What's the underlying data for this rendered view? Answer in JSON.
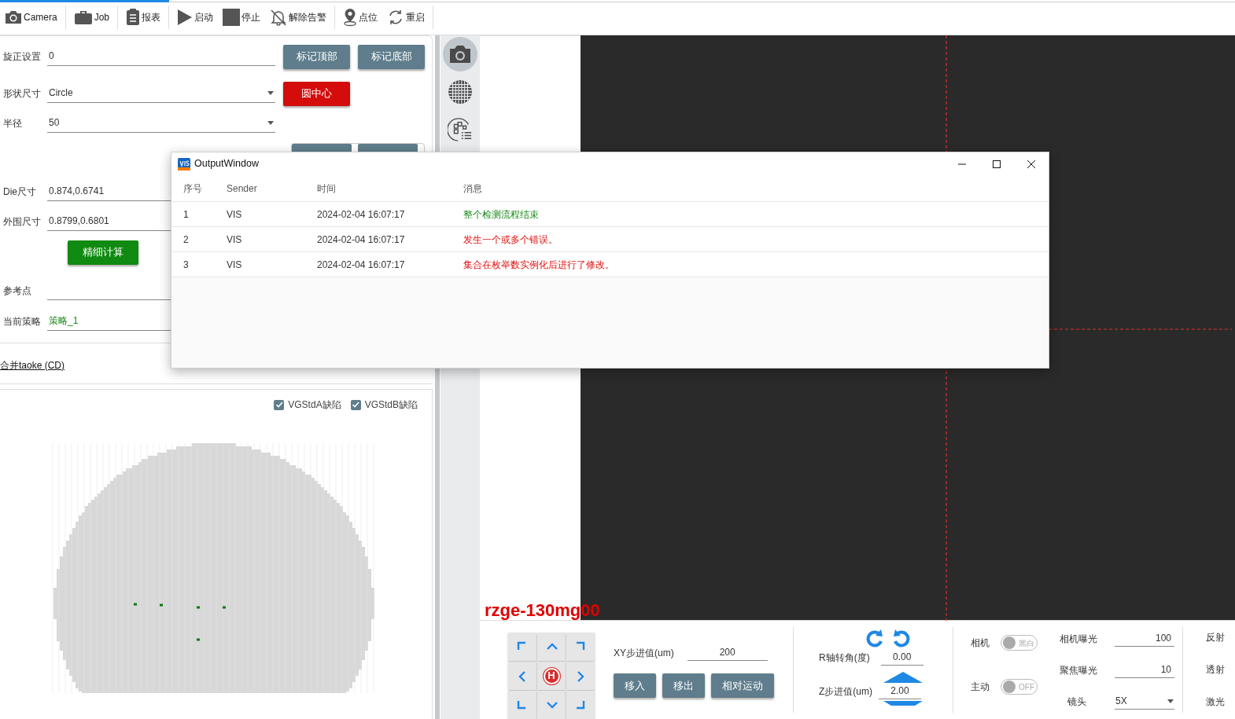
{
  "toolbar": {
    "items": [
      {
        "label": "Camera",
        "group_end": true
      },
      {
        "label": "Job",
        "group_end": true
      },
      {
        "label": "报表",
        "group_end": true
      },
      {
        "label": "启动",
        "group_end": false
      },
      {
        "label": "停止",
        "group_end": false
      },
      {
        "label": "解除告警",
        "group_end": true
      },
      {
        "label": "点位",
        "group_end": false
      },
      {
        "label": "重启",
        "group_end": true
      }
    ]
  },
  "settings": {
    "rows": [
      {
        "kind": "field",
        "label": "旋正设置",
        "value": "0",
        "buttons": [
          {
            "label": "标记顶部",
            "kind": "slate"
          },
          {
            "label": "标记底部",
            "kind": "slate"
          }
        ]
      },
      {
        "kind": "dropdown",
        "label": "形状尺寸",
        "value": "Circle",
        "buttons": [
          {
            "label": "圆中心",
            "kind": "danger"
          }
        ]
      },
      {
        "kind": "dropdown",
        "label": "半径",
        "value": "50"
      },
      {
        "kind": "covered_buttons",
        "buttons": [
          {
            "kind": "slate"
          },
          {
            "kind": "slate"
          }
        ]
      },
      {
        "kind": "field",
        "label": "Die尺寸",
        "value": "0.874,0.6741"
      },
      {
        "kind": "field",
        "label": "外围尺寸",
        "value": "0.8799,0.6801"
      },
      {
        "kind": "action",
        "buttons": [
          {
            "label": "精细计算",
            "kind": "success"
          }
        ]
      },
      {
        "kind": "field",
        "label": "参考点"
      },
      {
        "kind": "status",
        "label": "当前策略",
        "value": "策略_1"
      }
    ]
  },
  "merge_link": "合并taoke (CD)",
  "wafer_map": {
    "filters": [
      {
        "label": "VGStdA缺陷",
        "checked": true
      },
      {
        "label": "VGStdB缺陷",
        "checked": true
      }
    ]
  },
  "side_tools": [
    {
      "selected": true
    },
    {
      "selected": false
    },
    {
      "selected": false
    }
  ],
  "camera": {
    "device_label": "rzge-130mg00"
  },
  "motion": {
    "home": "H",
    "xy_step_label": "XY步进值(um)",
    "xy_step": "200",
    "buttons": [
      {
        "label": "移入"
      },
      {
        "label": "移出"
      },
      {
        "label": "相对运动"
      }
    ],
    "r_angle_label": "R轴转角(度)",
    "r_angle": "0.00",
    "z_step_label": "Z步进值(um)",
    "z_step": "2.00"
  },
  "toggles": [
    {
      "label": "相机",
      "text": "黑白",
      "on": false
    },
    {
      "label": "主动",
      "text": "OFF",
      "on": false
    }
  ],
  "exposure": [
    {
      "label": "相机曝光",
      "value": "100",
      "kind": "field"
    },
    {
      "label": "聚焦曝光",
      "value": "10",
      "kind": "field"
    },
    {
      "label": "镜头",
      "value": "5X",
      "kind": "dropdown"
    }
  ],
  "light_labels": [
    "反射",
    "透射",
    "激光"
  ],
  "output_window": {
    "title": "OutputWindow",
    "columns": [
      "序号",
      "Sender",
      "时间",
      "消息"
    ],
    "rows": [
      {
        "index": "1",
        "sender": "VIS",
        "time": "2024-02-04 16:07:17",
        "message": "整个检测流程结束",
        "kind": "info"
      },
      {
        "index": "2",
        "sender": "VIS",
        "time": "2024-02-04 16:07:17",
        "message": "发生一个或多个错误。",
        "kind": "error"
      },
      {
        "index": "3",
        "sender": "VIS",
        "time": "2024-02-04 16:07:17",
        "message": "集合在枚举数实例化后进行了修改。",
        "kind": "error"
      }
    ]
  }
}
